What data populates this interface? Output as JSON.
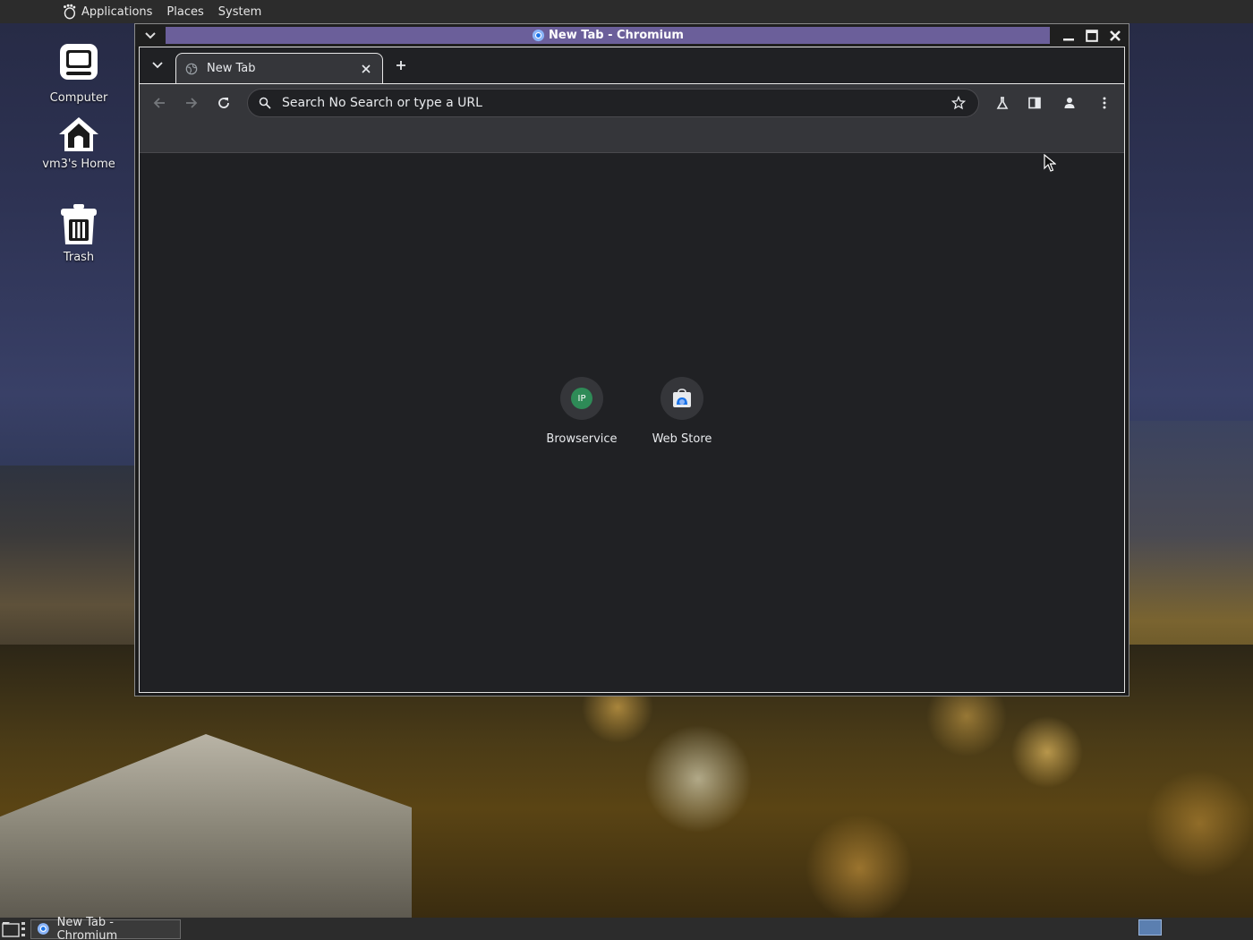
{
  "top_panel": {
    "menus": [
      "Applications",
      "Places",
      "System"
    ]
  },
  "desktop": {
    "icons": [
      {
        "label": "Computer"
      },
      {
        "label": "vm3's Home"
      },
      {
        "label": "Trash"
      }
    ]
  },
  "window": {
    "title": "New Tab - Chromium"
  },
  "browser": {
    "tabs": [
      {
        "title": "New Tab",
        "active": true
      }
    ],
    "omnibox": {
      "placeholder": "Search No Search or type a URL"
    },
    "shortcuts": [
      {
        "label": "Browservice",
        "icon": "ip-icon",
        "badge": "IP"
      },
      {
        "label": "Web Store",
        "icon": "web-store-icon"
      }
    ]
  },
  "taskbar": {
    "items": [
      {
        "label": "New Tab - Chromium"
      }
    ]
  },
  "colors": {
    "title_active": "#6b5f9a",
    "chrome_bg": "#202124",
    "toolbar_bg": "#35363a",
    "workspace": "#5b7fb0"
  }
}
